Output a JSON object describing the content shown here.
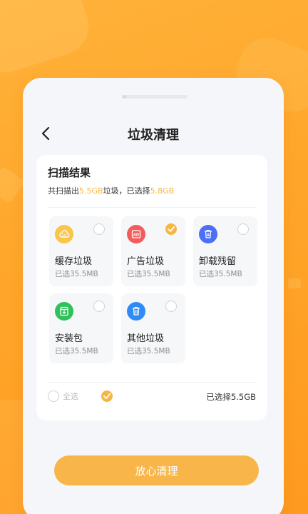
{
  "header": {
    "title": "垃圾清理"
  },
  "result": {
    "title": "扫描结果",
    "summary_prefix": "共扫描出",
    "scanned_size": "5.5GB",
    "summary_mid": "垃圾，已选择",
    "selected_size": "5.8GB"
  },
  "items": [
    {
      "name": "缓存垃圾",
      "size": "已选35.5MB",
      "checked": false,
      "icon": "cloud-cache-icon",
      "color": "#f9c54a"
    },
    {
      "name": "广告垃圾",
      "size": "已选35.5MB",
      "checked": true,
      "icon": "ad-icon",
      "color": "#f25c5c"
    },
    {
      "name": "卸载残留",
      "size": "已选35.5MB",
      "checked": false,
      "icon": "uninstall-trash-icon",
      "color": "#4b70f5"
    },
    {
      "name": "安装包",
      "size": "已选35.5MB",
      "checked": false,
      "icon": "package-download-icon",
      "color": "#2fc15a"
    },
    {
      "name": "其他垃圾",
      "size": "已选35.5MB",
      "checked": false,
      "icon": "trash-icon",
      "color": "#2f8cf5"
    }
  ],
  "footer": {
    "select_all": "全选",
    "selected_total": "已选择5.5GB"
  },
  "cta": {
    "label": "放心清理"
  },
  "colors": {
    "accent": "#f7b541",
    "background": "#ffa62a"
  }
}
